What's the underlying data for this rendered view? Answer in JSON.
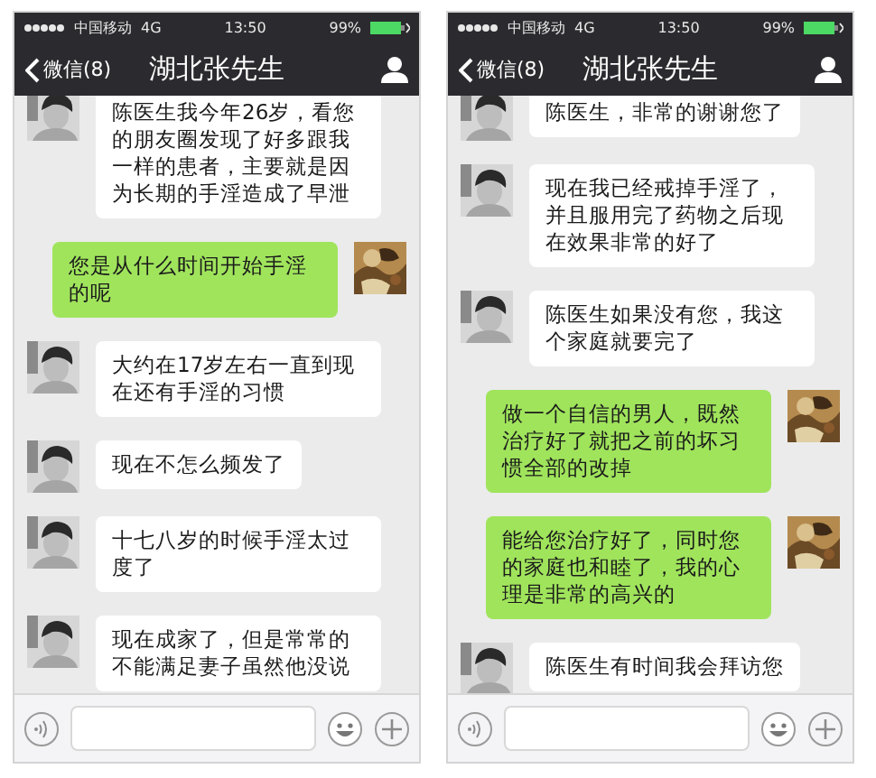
{
  "phones": [
    {
      "status_bar": {
        "carrier": "中国移动",
        "network": "4G",
        "time": "13:50",
        "battery": "99%"
      },
      "nav": {
        "back": "微信(8)",
        "title": "湖北张先生"
      },
      "messages": [
        {
          "kind": "received",
          "text": "陈医生我今年26岁，看您的朋友圈发现了好多跟我一样的患者，主要就是因为长期的手淫造成了早泄"
        },
        {
          "kind": "sent",
          "text": "您是从什么时间开始手淫的呢"
        },
        {
          "kind": "received",
          "text": "大约在17岁左右一直到现在还有手淫的习惯"
        },
        {
          "kind": "received",
          "text": "现在不怎么频发了"
        },
        {
          "kind": "received",
          "text": "十七八岁的时候手淫太过度了"
        },
        {
          "kind": "received",
          "text": "现在成家了，但是常常的不能满足妻子虽然他没说"
        }
      ]
    },
    {
      "status_bar": {
        "carrier": "中国移动",
        "network": "4G",
        "time": "13:50",
        "battery": "99%"
      },
      "nav": {
        "back": "微信(8)",
        "title": "湖北张先生"
      },
      "messages": [
        {
          "kind": "received",
          "text": "陈医生，非常的谢谢您了"
        },
        {
          "kind": "received",
          "text": "现在我已经戒掉手淫了，并且服用完了药物之后现在效果非常的好了"
        },
        {
          "kind": "received",
          "text": "陈医生如果没有您，我这个家庭就要完了"
        },
        {
          "kind": "sent",
          "text": "做一个自信的男人，既然治疗好了就把之前的坏习惯全部的改掉"
        },
        {
          "kind": "sent",
          "text": "能给您治疗好了，同时您的家庭也和睦了，我的心理是非常的高兴的"
        },
        {
          "kind": "received",
          "text": "陈医生有时间我会拜访您"
        }
      ]
    }
  ]
}
